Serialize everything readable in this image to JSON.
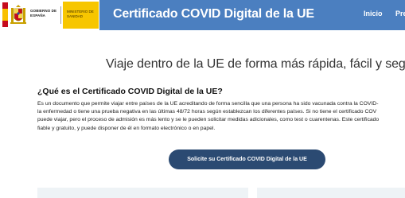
{
  "header": {
    "gov_label": "Gobierno de España",
    "ministry_label": "Ministerio de Sanidad",
    "site_title": "Certificado COVID Digital de la UE",
    "nav": [
      {
        "label": "Inicio"
      },
      {
        "label": "Preguntas"
      }
    ],
    "colors": {
      "header_bg": "#4b7fc0",
      "ministry_yellow": "#f7c600",
      "flag_red": "#c60b1e",
      "flag_yellow": "#f9c000"
    },
    "icons": [
      "spain-flag-icon",
      "coat-of-arms-icon"
    ]
  },
  "main": {
    "hero": "Viaje dentro de la UE de forma más rápida, fácil y segura",
    "question_title": "¿Qué es el Certificado COVID Digital de la UE?",
    "paragraph_lines": [
      "Es un documento que permite viajar entre países de la UE acreditando de forma sencilla que una persona ha sido vacunada contra la COVID-",
      "la enfermedad o tiene una prueba negativa en las últimas 48/72 horas según establezcan los diferentes países. Si no tiene el certificado COV",
      "puede viajar, pero el proceso de admisión es más lento y se le pueden solicitar medidas adicionales, como test o cuarentenas. Este certificado",
      "fiable y gratuito, y puede disponer de él en formato electrónico o en papel."
    ],
    "cta_label": "Solicite su Certificado COVID Digital de la UE",
    "cta_color": "#2b4a72"
  }
}
